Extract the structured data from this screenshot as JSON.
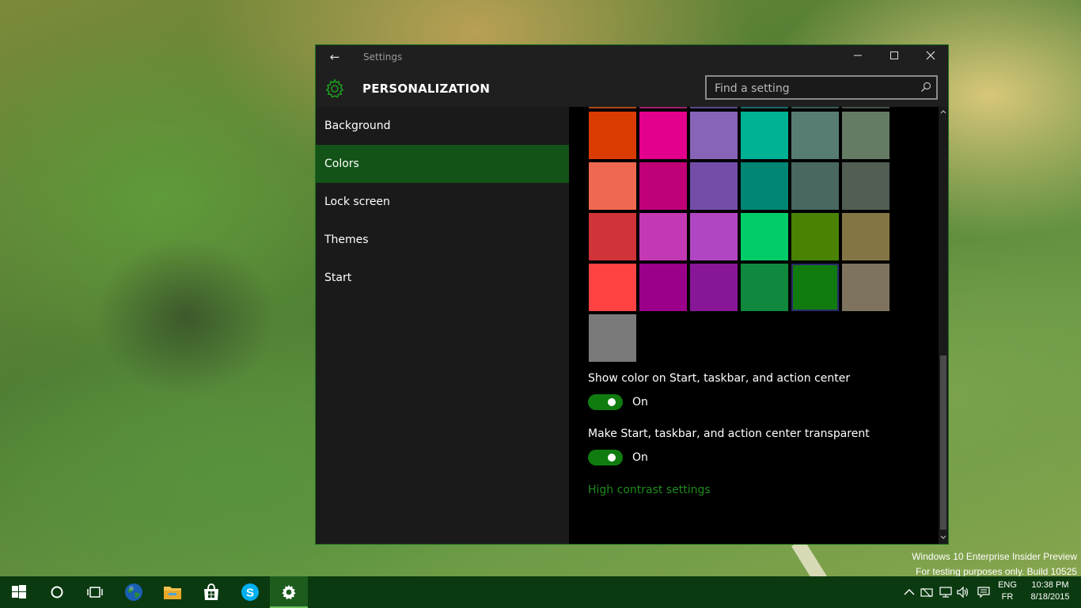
{
  "window": {
    "title": "Settings",
    "back_glyph": "←",
    "minimize_glyph": "—",
    "maximize_glyph": "☐",
    "close_glyph": "✕"
  },
  "header": {
    "title": "PERSONALIZATION",
    "search_placeholder": "Find a setting"
  },
  "sidebar": {
    "items": [
      {
        "label": "Background",
        "active": false
      },
      {
        "label": "Colors",
        "active": true
      },
      {
        "label": "Lock screen",
        "active": false
      },
      {
        "label": "Themes",
        "active": false
      },
      {
        "label": "Start",
        "active": false
      }
    ]
  },
  "colors": {
    "rows": [
      [
        "#DA3B01",
        "#E3008C",
        "#8764B8",
        "#00B294",
        "#567C73",
        "#647C64"
      ],
      [
        "#EF6950",
        "#BF0077",
        "#744DA9",
        "#018574",
        "#486860",
        "#525E54"
      ],
      [
        "#D13438",
        "#C239B3",
        "#B146C2",
        "#00CC6A",
        "#498205",
        "#847545"
      ],
      [
        "#FF4343",
        "#9A0089",
        "#881798",
        "#10893E",
        "#107C10",
        "#7E735F"
      ],
      [
        "#7A7A7A"
      ]
    ],
    "selected_color": "#107C10",
    "show_color_label": "Show color on Start, taskbar, and action center",
    "show_color_state": "On",
    "transparent_label": "Make Start, taskbar, and action center transparent",
    "transparent_state": "On",
    "high_contrast_link": "High contrast settings",
    "accent": "#107C10"
  },
  "watermark": {
    "line1": "Windows 10 Enterprise Insider Preview",
    "line2": "For testing purposes only. Build 10525"
  },
  "taskbar": {
    "apps": [
      "start-icon",
      "cortana-icon",
      "task-view-icon",
      "browser-globe-icon",
      "file-explorer-icon",
      "store-icon",
      "skype-icon",
      "settings-gear-icon"
    ],
    "lang_top": "ENG",
    "lang_bottom": "FR",
    "time": "10:38 PM",
    "date": "8/18/2015"
  }
}
